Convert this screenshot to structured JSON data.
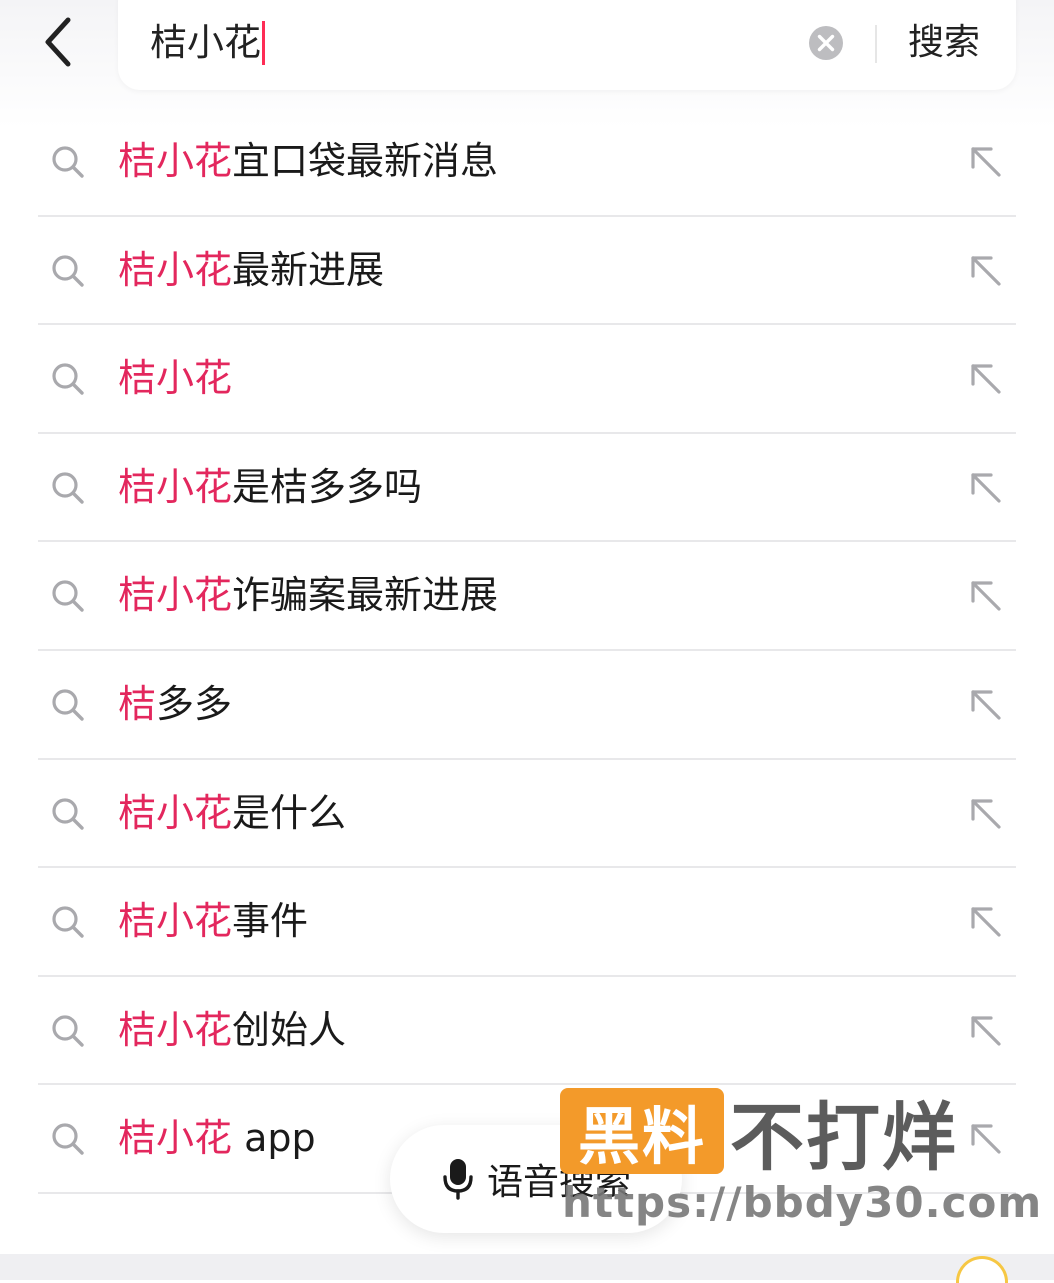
{
  "search": {
    "query": "桔小花",
    "submit_label": "搜索"
  },
  "suggestions": [
    {
      "highlight": "桔小花",
      "rest": "宜口袋最新消息"
    },
    {
      "highlight": "桔小花",
      "rest": "最新进展"
    },
    {
      "highlight": "桔小花",
      "rest": ""
    },
    {
      "highlight": "桔小花",
      "rest": "是桔多多吗"
    },
    {
      "highlight": "桔小花",
      "rest": "诈骗案最新进展"
    },
    {
      "highlight": "桔",
      "rest": "多多"
    },
    {
      "highlight": "桔小花",
      "rest": "是什么"
    },
    {
      "highlight": "桔小花",
      "rest": "事件"
    },
    {
      "highlight": "桔小花",
      "rest": "创始人"
    },
    {
      "highlight": "桔小花",
      "rest": " app"
    }
  ],
  "voice_search": {
    "label": "语音搜索"
  },
  "watermark": {
    "box_text": "黑料",
    "tail_text": "不打烊",
    "url": "https://bbdy30.com"
  },
  "colors": {
    "accent": "#fe2c55",
    "highlight_text": "#e3275d",
    "watermark_orange": "#f39a2a"
  },
  "icons": {
    "back": "chevron-left-icon",
    "clear": "clear-circle-icon",
    "suggestion": "search-icon",
    "fill": "arrow-up-left-icon",
    "voice": "microphone-icon"
  }
}
